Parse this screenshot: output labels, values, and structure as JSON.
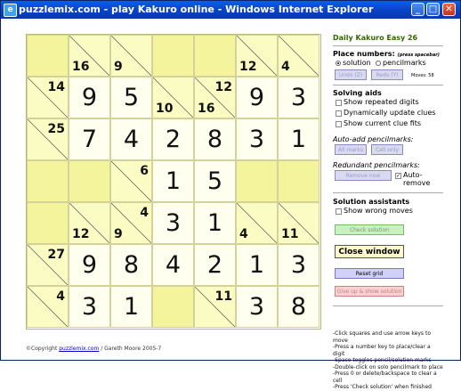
{
  "window": {
    "title": "puzzlemix.com - play Kakuro online - Windows Internet Explorer",
    "minimize": "_",
    "maximize": "□",
    "close": "✕"
  },
  "puzzle": {
    "title": "Daily Kakuro Easy 26",
    "grid": [
      [
        {
          "t": "b"
        },
        {
          "t": "c",
          "d": "16"
        },
        {
          "t": "c",
          "d": "9"
        },
        {
          "t": "b"
        },
        {
          "t": "b"
        },
        {
          "t": "c",
          "d": "12"
        },
        {
          "t": "c",
          "d": "4"
        }
      ],
      [
        {
          "t": "c",
          "r": "14"
        },
        {
          "t": "v",
          "v": "9"
        },
        {
          "t": "v",
          "v": "5"
        },
        {
          "t": "c",
          "d": "10"
        },
        {
          "t": "c",
          "d": "16",
          "r": "12"
        },
        {
          "t": "v",
          "v": "9"
        },
        {
          "t": "v",
          "v": "3"
        }
      ],
      [
        {
          "t": "c",
          "r": "25"
        },
        {
          "t": "v",
          "v": "7"
        },
        {
          "t": "v",
          "v": "4"
        },
        {
          "t": "v",
          "v": "2"
        },
        {
          "t": "v",
          "v": "8"
        },
        {
          "t": "v",
          "v": "3"
        },
        {
          "t": "v",
          "v": "1"
        }
      ],
      [
        {
          "t": "b"
        },
        {
          "t": "b"
        },
        {
          "t": "c",
          "r": "6"
        },
        {
          "t": "v",
          "v": "1"
        },
        {
          "t": "v",
          "v": "5"
        },
        {
          "t": "b"
        },
        {
          "t": "b"
        }
      ],
      [
        {
          "t": "b"
        },
        {
          "t": "c",
          "d": "12"
        },
        {
          "t": "c",
          "d": "9",
          "r": "4"
        },
        {
          "t": "v",
          "v": "3"
        },
        {
          "t": "v",
          "v": "1"
        },
        {
          "t": "c",
          "d": "4"
        },
        {
          "t": "c",
          "d": "11"
        }
      ],
      [
        {
          "t": "c",
          "r": "27"
        },
        {
          "t": "v",
          "v": "9"
        },
        {
          "t": "v",
          "v": "8"
        },
        {
          "t": "v",
          "v": "4"
        },
        {
          "t": "v",
          "v": "2"
        },
        {
          "t": "v",
          "v": "1"
        },
        {
          "t": "v",
          "v": "3"
        }
      ],
      [
        {
          "t": "c",
          "r": "4"
        },
        {
          "t": "v",
          "v": "3"
        },
        {
          "t": "v",
          "v": "1"
        },
        {
          "t": "b"
        },
        {
          "t": "c",
          "r": "11"
        },
        {
          "t": "v",
          "v": "3"
        },
        {
          "t": "v",
          "v": "8"
        }
      ]
    ]
  },
  "copyright": {
    "prefix": "©Copyright ",
    "link": "puzzlemix.com",
    "suffix": " / Gareth Moore 2005-7"
  },
  "panel": {
    "place_numbers": "Place numbers:",
    "press_spacebar": "(press spacebar)",
    "mode_solution": "solution",
    "mode_pencilmarks": "pencilmarks",
    "undo_button": "Undo (Z)",
    "redo_button": "Redo (Y)",
    "moves": "Moves: 58",
    "solving_aids": "Solving aids",
    "show_repeated": "Show repeated digits",
    "dynamic_update": "Dynamically update clues",
    "show_clue_fits": "Show current clue fits",
    "auto_add": "Auto-add pencilmarks:",
    "all_marks_button": "All marks",
    "cell_only_button": "Cell only",
    "redundant": "Redundant pencilmarks:",
    "remove_now_button": "Remove now",
    "auto_remove": "Auto-remove",
    "solution_assistants": "Solution assistants",
    "show_wrong": "Show wrong moves",
    "check_solution_button": "Check solution",
    "close_window_button": "Close window",
    "reset_grid_button": "Reset grid",
    "give_up_button": "Give up & show solution",
    "help_lines": [
      "-Click squares and use arrow keys to move",
      "-Press a number key to place/clear a digit",
      "-Space toggles pencil/solution marks",
      "-Double-click on solo pencilmark to place",
      "-Press 0 or delete/backspace to clear a cell",
      "-Press 'Check solution' when finished"
    ]
  }
}
